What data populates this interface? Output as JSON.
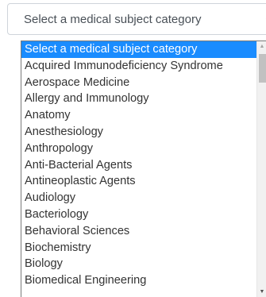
{
  "select": {
    "value": "Select a medical subject category",
    "arrow_icon": "chevron-down-icon"
  },
  "dropdown": {
    "options": [
      "Select a medical subject category",
      "Acquired Immunodeficiency Syndrome",
      "Aerospace Medicine",
      "Allergy and Immunology",
      "Anatomy",
      "Anesthesiology",
      "Anthropology",
      "Anti-Bacterial Agents",
      "Antineoplastic Agents",
      "Audiology",
      "Bacteriology",
      "Behavioral Sciences",
      "Biochemistry",
      "Biology",
      "Biomedical Engineering"
    ],
    "selected_index": 0,
    "highlight_color": "#1a8cff"
  },
  "scrollbar": {
    "up_icon": "scroll-up-arrow-icon",
    "down_icon": "scroll-down-arrow-icon"
  }
}
